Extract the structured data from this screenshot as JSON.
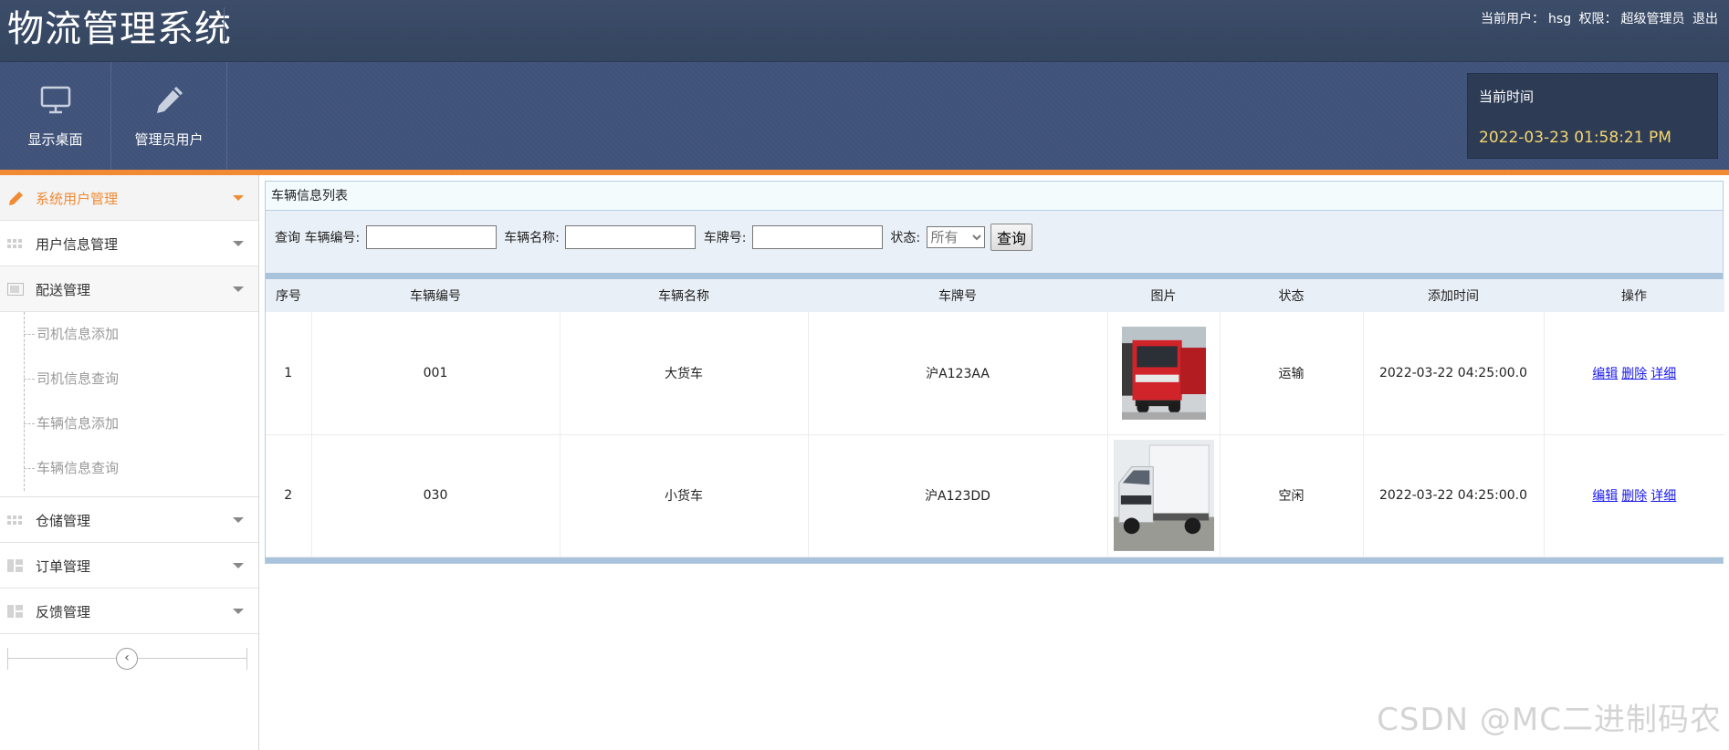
{
  "header": {
    "app_title": "物流管理系统",
    "current_user_label": "当前用户：",
    "current_user": "hsg",
    "role_label": "权限：",
    "role": "超级管理员",
    "logout_label": "退出"
  },
  "toolbar": {
    "desktop_label": "显示桌面",
    "admin_label": "管理员用户",
    "time_label": "当前时间",
    "time_value": "2022-03-23 01:58:21 PM"
  },
  "colors": {
    "accent": "#f08a35",
    "header_bg": "#3c4d6a",
    "time_text": "#f5d76e",
    "link": "#1a1aee"
  },
  "sidebar": {
    "menu_system_users": "系统用户管理",
    "menu_user_info": "用户信息管理",
    "menu_delivery": "配送管理",
    "sub_driver_add": "司机信息添加",
    "sub_driver_query": "司机信息查询",
    "sub_vehicle_add": "车辆信息添加",
    "sub_vehicle_query": "车辆信息查询",
    "menu_warehouse": "仓储管理",
    "menu_orders": "订单管理",
    "menu_feedback": "反馈管理"
  },
  "main": {
    "panel_title": "车辆信息列表",
    "search": {
      "query_label": "查询",
      "vehicle_no_label": "车辆编号:",
      "vehicle_no_value": "",
      "vehicle_name_label": "车辆名称:",
      "vehicle_name_value": "",
      "plate_label": "车牌号:",
      "plate_value": "",
      "status_label": "状态:",
      "status_selected": "所有",
      "button_label": "查询"
    },
    "table": {
      "headers": [
        "序号",
        "车辆编号",
        "车辆名称",
        "车牌号",
        "图片",
        "状态",
        "添加时间",
        "操作"
      ],
      "rows": [
        {
          "index": "1",
          "vehicle_no": "001",
          "name": "大货车",
          "plate": "沪A123AA",
          "image": "red-truck-image",
          "status": "运输",
          "added": "2022-03-22 04:25:00.0"
        },
        {
          "index": "2",
          "vehicle_no": "030",
          "name": "小货车",
          "plate": "沪A123DD",
          "image": "white-van-image",
          "status": "空闲",
          "added": "2022-03-22 04:25:00.0"
        }
      ],
      "actions": {
        "edit": "编辑",
        "delete": "删除",
        "detail": "详细"
      }
    }
  },
  "watermark": "CSDN @MC二进制码农"
}
